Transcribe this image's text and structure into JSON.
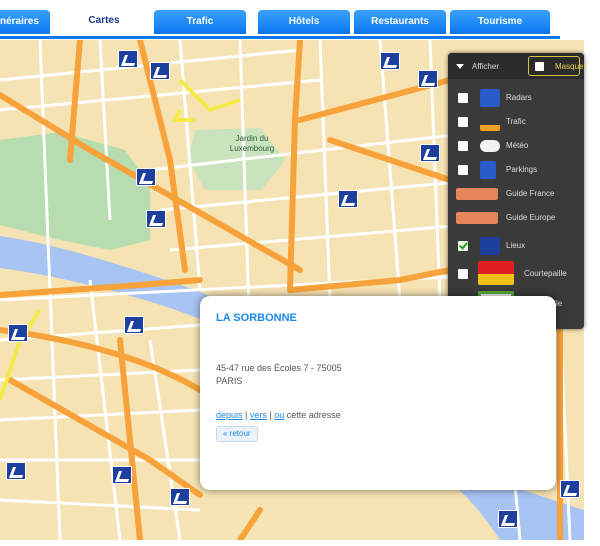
{
  "tabs": [
    {
      "label": "Itinéraires",
      "active": false
    },
    {
      "label": "Cartes",
      "active": true
    },
    {
      "label": "Trafic",
      "active": false
    },
    {
      "label": "Hôtels",
      "active": false
    },
    {
      "label": "Restaurants",
      "active": false
    },
    {
      "label": "Tourisme",
      "active": false
    }
  ],
  "legend": {
    "dropdown_label": "Afficher",
    "hide_label": "Masquer",
    "items": [
      {
        "label": "Radars",
        "checked": false,
        "icon": "radar-icon"
      },
      {
        "label": "Trafic",
        "checked": false,
        "icon": "traffic-cone-icon"
      },
      {
        "label": "Météo",
        "checked": false,
        "icon": "weather-cloud-icon"
      },
      {
        "label": "Parkings",
        "checked": false,
        "icon": "parking-icon"
      },
      {
        "label": "Guide France",
        "checked": false,
        "icon": "guide-france-icon"
      },
      {
        "label": "Guide Europe",
        "checked": false,
        "icon": "guide-europe-icon"
      },
      {
        "label": "Lieux",
        "checked": true,
        "icon": "place-marker-icon"
      },
      {
        "label": "Courtepaille",
        "checked": false,
        "icon": "courtepaille-logo-icon"
      },
      {
        "label": "Campanile",
        "checked": false,
        "icon": "campanile-logo-icon"
      }
    ]
  },
  "popup": {
    "title": "LA SORBONNE",
    "address_line1": "45-47 rue des Écoles 7 - 75005",
    "address_line2": "PARIS",
    "link_from": "depuis",
    "link_to": "vers",
    "link_near": "ou",
    "link_suffix": "cette adresse",
    "back_label": "« retour"
  },
  "map": {
    "park_label": "Jardin du Luxembourg"
  },
  "colors": {
    "tab_blue": "#0a78ee",
    "map_bg": "#f6e3b4",
    "road_major": "#f7a23a",
    "road_minor": "#ffffff",
    "river": "#a7c4f2",
    "park": "#b7dcb0",
    "marker": "#1d3f9e",
    "popup_title": "#1a8ae8"
  }
}
